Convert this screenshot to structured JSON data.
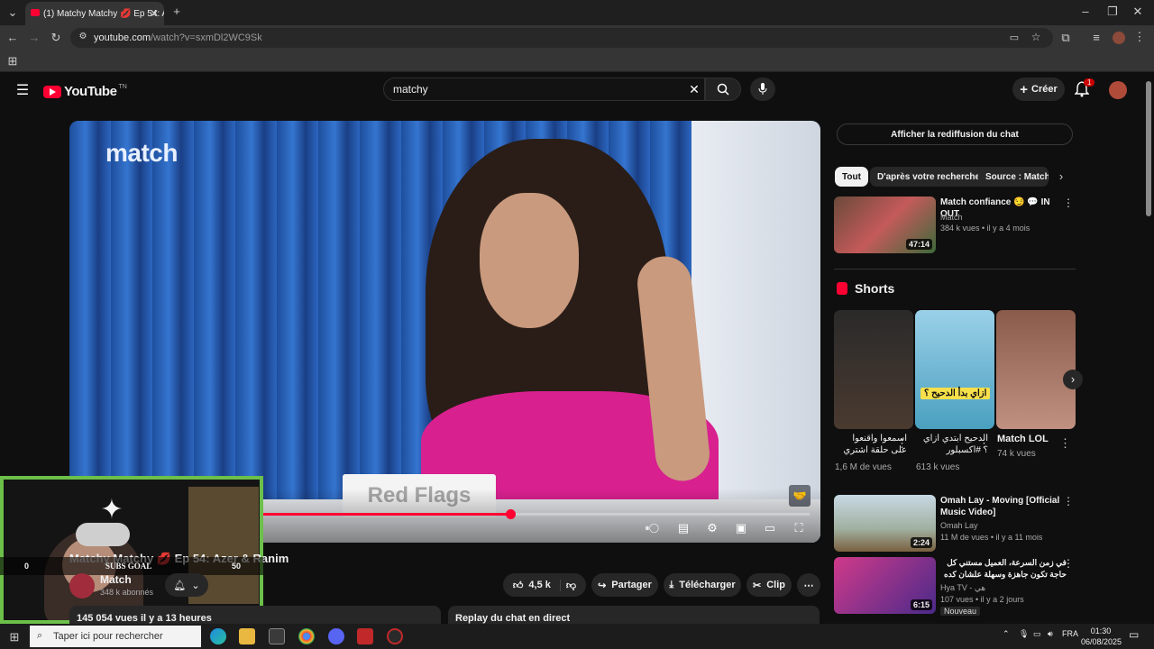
{
  "browser": {
    "tab_title": "(1) Matchy Matchy 💋 Ep 54: A",
    "url_host": "youtube.com",
    "url_path": "/watch?v=sxmDl2WC9Sk"
  },
  "header": {
    "logo_text": "YouTube",
    "logo_country": "TN",
    "search_value": "matchy",
    "create_label": "Créer",
    "notification_count": "1"
  },
  "player": {
    "brand_watermark": "match",
    "nameplate": "Red Flags",
    "progress_fraction": 0.59
  },
  "webcam": {
    "goal_label": "SUBS GOAL",
    "goal_min": "0",
    "goal_max": "50"
  },
  "video": {
    "title": "Matchy Matchy 💋 Ep 54: Azer & Ranim",
    "channel": "Match",
    "subscribers": "348 k abonnés",
    "likes": "4,5 k",
    "share_label": "Partager",
    "download_label": "Télécharger",
    "clip_label": "Clip",
    "views_date": "145 054 vues  il y a 13 heures",
    "replay_label": "Replay du chat en direct"
  },
  "sidebar": {
    "chat_replay_button": "Afficher la rediffusion du chat",
    "chips": [
      "Tout",
      "D'après votre recherche",
      "Source : Match"
    ],
    "recommendations": [
      {
        "title": "Match confiance 😏 💬 IN OUT",
        "channel": "Match",
        "meta": "384 k vues • il y a 4 mois",
        "duration": "47:14",
        "badge": ""
      },
      {
        "title": "Omah Lay - Moving [Official Music Video]",
        "channel": "Omah Lay",
        "meta": "11 M de vues • il y a 11 mois",
        "duration": "2:24",
        "badge": ""
      },
      {
        "title": "في زمن السرعة، العميل مستني كل حاجة تكون جاهزة وسهلة علشان كده التاجر الشاطر",
        "channel": "Hya TV - هي",
        "meta": "107 vues • il y a 2 jours",
        "duration": "6:15",
        "badge": "Nouveau"
      }
    ],
    "shorts_title": "Shorts",
    "shorts": [
      {
        "title": "اسمعوا واقنعوا على حلقة اشتري",
        "views": "1,6 M de vues"
      },
      {
        "title": "الدحيح ابتدي ازاي ؟ #اكسبلور",
        "views": "613 k vues"
      },
      {
        "title": "Match LOL",
        "views": "74 k vues"
      }
    ],
    "short_overlay_text": "ازاي بدأ الدحيح ؟"
  },
  "taskbar": {
    "search_placeholder": "Taper ici pour rechercher",
    "lang": "FRA",
    "time": "01:30",
    "date": "06/08/2025"
  },
  "colors": {
    "brand_red": "#ff0033",
    "webcam_border": "#6cc04a",
    "bg": "#0f0f0f"
  }
}
